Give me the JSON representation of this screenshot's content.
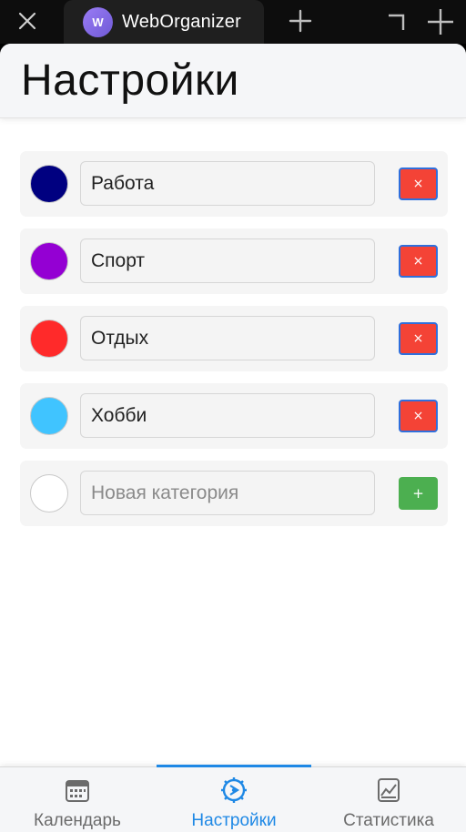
{
  "window": {
    "tab_title": "WebOrganizer",
    "tab_avatar_letter": "W",
    "icons": [
      "close-icon",
      "plus-icon",
      "restore-icon",
      "minimize-icon"
    ]
  },
  "header": {
    "title": "Настройки"
  },
  "categories": [
    {
      "name": "Работа",
      "color": "#000080",
      "delete_label": "×"
    },
    {
      "name": "Спорт",
      "color": "#9400D3",
      "delete_label": "×"
    },
    {
      "name": "Отдых",
      "color": "#FF2A2A",
      "delete_label": "×"
    },
    {
      "name": "Хобби",
      "color": "#40C4FF",
      "delete_label": "×"
    }
  ],
  "new_category": {
    "value": "",
    "placeholder": "Новая категория",
    "color": "#FFFFFF",
    "add_label": "+"
  },
  "bottom_nav": {
    "items": [
      {
        "label": "Календарь",
        "icon": "calendar-icon",
        "active": false
      },
      {
        "label": "Настройки",
        "icon": "settings-icon",
        "active": true
      },
      {
        "label": "Статистика",
        "icon": "chart-icon",
        "active": false
      }
    ]
  },
  "colors": {
    "accent": "#1E88E5",
    "delete": "#F44336",
    "add": "#4CAF50"
  }
}
